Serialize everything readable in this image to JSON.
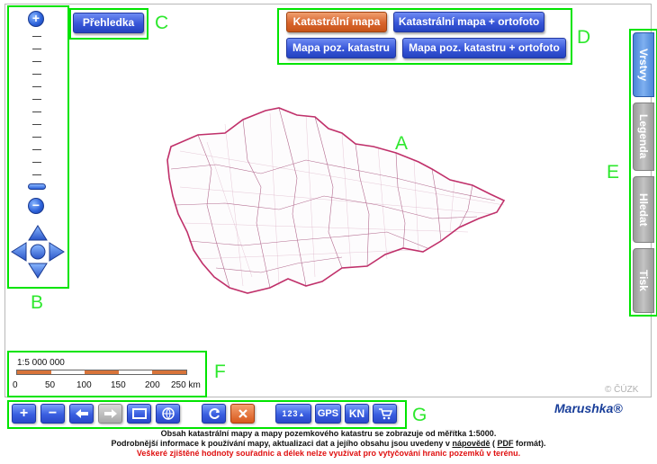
{
  "overview_button": "Přehledka",
  "map_modes": [
    "Katastrální mapa",
    "Katastrální mapa + ortofoto",
    "Mapa poz. katastru",
    "Mapa poz. katastru + ortofoto"
  ],
  "active_map_mode": "Katastrální mapa",
  "side_tabs": [
    "Vrstvy",
    "Legenda",
    "Hledat",
    "Tisk"
  ],
  "active_side_tab": "Vrstvy",
  "scale": {
    "label": "1:5 000 000",
    "ticks": [
      "0",
      "50",
      "100",
      "150",
      "200",
      "250 km"
    ]
  },
  "annotations": [
    "A",
    "B",
    "C",
    "D",
    "E",
    "F",
    "G"
  ],
  "copyright": "© ČÚZK",
  "brand": "Marushka®",
  "toolbar": {
    "gps": "GPS",
    "kn": "KN",
    "measure": "123"
  },
  "footer": {
    "line1": "Obsah katastrální mapy a mapy pozemkového katastru se zobrazuje od měřítka 1:5000.",
    "line2_pre": "Podrobnější informace k používání mapy, aktualizaci dat a jejího obsahu jsou uvedeny v",
    "line2_link": "nápovědě",
    "line2_mid": " (",
    "line2_pdf": "PDF",
    "line2_post": " formát).",
    "line3": "Veškeré zjištěné hodnoty souřadnic a délek nelze využívat pro vytyčování hranic pozemků v terénu."
  },
  "colors": {
    "accent_blue": "#3856d8",
    "accent_orange": "#d8642c",
    "annotation_green": "#00e400",
    "map_boundary": "#c0306a",
    "warning_red": "#e01010"
  }
}
